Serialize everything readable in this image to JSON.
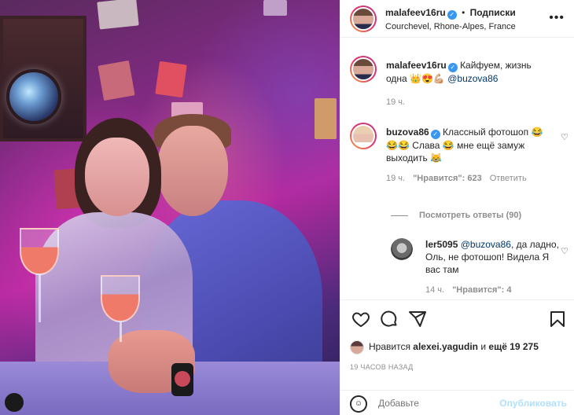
{
  "post": {
    "author": "malafeev16ru",
    "follow_label": "Подписки",
    "location": "Courchevel, Rhone-Alpes, France",
    "more_label": "•••"
  },
  "caption": {
    "author": "malafeev16ru",
    "text": "Кайфуем, жизнь одна 👑😍💪🏼",
    "mention": "@buzova86",
    "time": "19 ч."
  },
  "comments": [
    {
      "author": "buzova86",
      "text": "Классный фотошоп 😂😂😂 Слава 😂 мне ещё замуж выходить 😹",
      "time": "19 ч.",
      "likes_label": "\"Нравится\": 623",
      "reply_label": "Ответить",
      "view_replies": "Посмотреть ответы (90)"
    },
    {
      "author": "ler5095",
      "mention": "@buzova86",
      "text": ", да ладно, Оль, не фотошоп! Видела Я вас там",
      "time": "14 ч.",
      "likes_label": "\"Нравится\": 4"
    }
  ],
  "likes": {
    "prefix": "Нравится",
    "user": "alexei.yagudin",
    "middle": "и",
    "rest": "ещё 19 275"
  },
  "time_ago": "19 ЧАСОВ НАЗАД",
  "add_comment": {
    "placeholder": "Добавьте",
    "publish_label": "Опубликовать"
  },
  "icons": {
    "heart": "heart-icon",
    "comment": "comment-icon",
    "share": "share-icon",
    "save": "bookmark-icon",
    "emoji": "emoji-icon",
    "verified": "verified-icon"
  },
  "colors": {
    "verified": "#3897f0",
    "mention": "#00376b",
    "muted": "#8e8e8e",
    "publish_disabled": "#b2dffc"
  }
}
